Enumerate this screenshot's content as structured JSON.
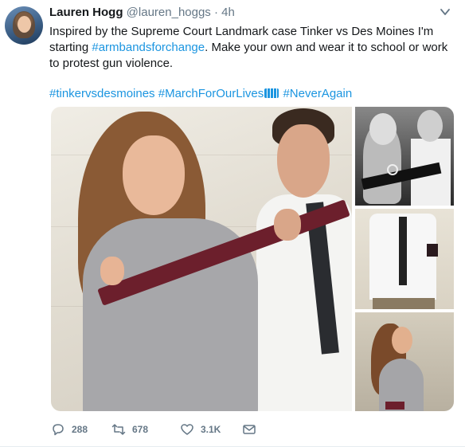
{
  "tweet": {
    "name": "Lauren Hogg",
    "handle": "@lauren_hoggs",
    "dot": "·",
    "time": "4h",
    "text_part1": "Inspired by the Supreme Court Landmark case Tinker vs Des Moines I'm starting ",
    "text_hashtag1": "#armbandsforchange",
    "text_part2": ". Make your own and wear it to school or work to protest gun violence.",
    "hashtags": [
      "#tinkervsdesmoines",
      "#MarchForOurLives",
      "#NeverAgain"
    ]
  },
  "actions": {
    "replies": "288",
    "retweets": "678",
    "likes": "3.1K"
  },
  "icons": {
    "caret": "chevron-down-icon",
    "reply": "reply-icon",
    "retweet": "retweet-icon",
    "like": "heart-icon",
    "dm": "envelope-icon",
    "emoji": "people-holding-hands-emoji"
  },
  "colors": {
    "link": "#1b95e0",
    "text": "#14171a",
    "muted": "#657786"
  }
}
